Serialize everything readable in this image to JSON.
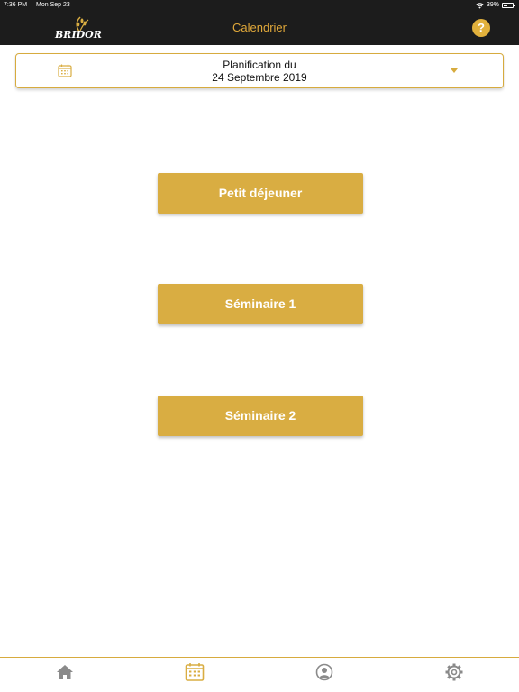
{
  "status_bar": {
    "time": "7:36 PM",
    "date": "Mon Sep 23",
    "battery": "39%",
    "battery_level": 0.39
  },
  "header": {
    "logo_text": "BRIDOR",
    "title": "Calendrier",
    "help_label": "?"
  },
  "date_picker": {
    "label_line1": "Planification du",
    "label_line2": "24 Septembre 2019"
  },
  "events": [
    {
      "label": "Petit déjeuner"
    },
    {
      "label": "Séminaire 1"
    },
    {
      "label": "Séminaire 2"
    }
  ],
  "tab_bar": {
    "tabs": [
      {
        "icon": "home-icon",
        "active": false
      },
      {
        "icon": "calendar-icon",
        "active": true
      },
      {
        "icon": "profile-icon",
        "active": false
      },
      {
        "icon": "gear-icon",
        "active": false
      }
    ]
  },
  "colors": {
    "accent": "#d9ad42",
    "header_bg": "#1c1c1c",
    "inactive_icon": "#8a8a8a"
  }
}
